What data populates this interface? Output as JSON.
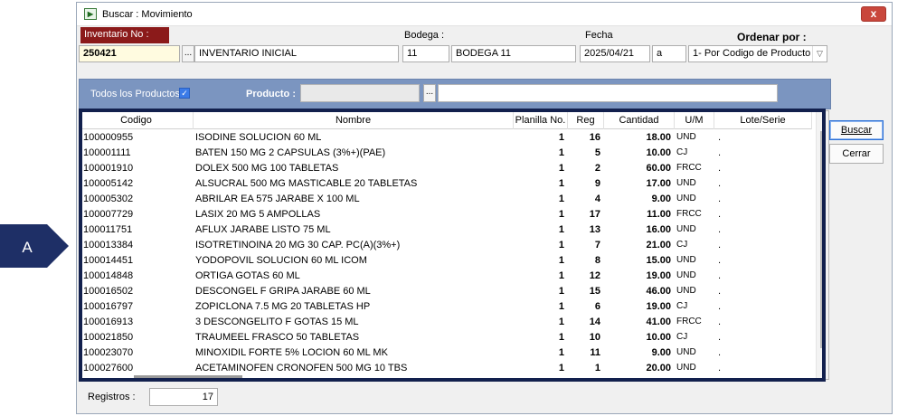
{
  "window": {
    "title": "Buscar : Movimiento",
    "close": "x"
  },
  "form": {
    "inventario_label": "Inventario No  :",
    "inventario_no": "250421",
    "inventario_desc": "INVENTARIO INICIAL",
    "bodega_label": "Bodega :",
    "bodega_code": "11",
    "bodega_name": "BODEGA 11",
    "fecha_label": "Fecha",
    "fecha": "2025/04/21",
    "fecha_a": "a",
    "ordenar_label": "Ordenar por :",
    "ordenar_value": "1- Por Codigo de Producto",
    "dots": "..."
  },
  "filter": {
    "todos_label": "Todos los Productos",
    "todos_checked": "✓",
    "producto_label": "Producto :",
    "dots": "..."
  },
  "grid": {
    "columns": [
      "Codigo",
      "Nombre",
      "Planilla No.",
      "Reg",
      "Cantidad",
      "U/M",
      "Lote/Serie"
    ],
    "rows": [
      {
        "codigo": "100000955",
        "nombre": "ISODINE SOLUCION 60 ML",
        "planilla": "1",
        "reg": "16",
        "cantidad": "18.00",
        "um": "UND",
        "lote": "."
      },
      {
        "codigo": "100001111",
        "nombre": "BATEN 150 MG 2 CAPSULAS (3%+)(PAE)",
        "planilla": "1",
        "reg": "5",
        "cantidad": "10.00",
        "um": "CJ",
        "lote": "."
      },
      {
        "codigo": "100001910",
        "nombre": "DOLEX 500 MG 100 TABLETAS",
        "planilla": "1",
        "reg": "2",
        "cantidad": "60.00",
        "um": "FRCC",
        "lote": "."
      },
      {
        "codigo": "100005142",
        "nombre": "ALSUCRAL 500 MG MASTICABLE 20 TABLETAS",
        "planilla": "1",
        "reg": "9",
        "cantidad": "17.00",
        "um": "UND",
        "lote": "."
      },
      {
        "codigo": "100005302",
        "nombre": "ABRILAR EA 575 JARABE X 100 ML",
        "planilla": "1",
        "reg": "4",
        "cantidad": "9.00",
        "um": "UND",
        "lote": "."
      },
      {
        "codigo": "100007729",
        "nombre": "LASIX 20 MG 5 AMPOLLAS",
        "planilla": "1",
        "reg": "17",
        "cantidad": "11.00",
        "um": "FRCC",
        "lote": "."
      },
      {
        "codigo": "100011751",
        "nombre": "AFLUX JARABE LISTO 75 ML",
        "planilla": "1",
        "reg": "13",
        "cantidad": "16.00",
        "um": "UND",
        "lote": "."
      },
      {
        "codigo": "100013384",
        "nombre": "ISOTRETINOINA 20 MG 30 CAP. PC(A)(3%+)",
        "planilla": "1",
        "reg": "7",
        "cantidad": "21.00",
        "um": "CJ",
        "lote": "."
      },
      {
        "codigo": "100014451",
        "nombre": "YODOPOVIL SOLUCION 60 ML ICOM",
        "planilla": "1",
        "reg": "8",
        "cantidad": "15.00",
        "um": "UND",
        "lote": "."
      },
      {
        "codigo": "100014848",
        "nombre": "ORTIGA GOTAS 60 ML",
        "planilla": "1",
        "reg": "12",
        "cantidad": "19.00",
        "um": "UND",
        "lote": "."
      },
      {
        "codigo": "100016502",
        "nombre": "DESCONGEL F GRIPA JARABE 60 ML",
        "planilla": "1",
        "reg": "15",
        "cantidad": "46.00",
        "um": "UND",
        "lote": "."
      },
      {
        "codigo": "100016797",
        "nombre": "ZOPICLONA 7.5 MG 20 TABLETAS HP",
        "planilla": "1",
        "reg": "6",
        "cantidad": "19.00",
        "um": "CJ",
        "lote": "."
      },
      {
        "codigo": "100016913",
        "nombre": "3 DESCONGELITO F GOTAS 15 ML",
        "planilla": "1",
        "reg": "14",
        "cantidad": "41.00",
        "um": "FRCC",
        "lote": "."
      },
      {
        "codigo": "100021850",
        "nombre": "TRAUMEEL FRASCO 50 TABLETAS",
        "planilla": "1",
        "reg": "10",
        "cantidad": "10.00",
        "um": "CJ",
        "lote": "."
      },
      {
        "codigo": "100023070",
        "nombre": "MINOXIDIL FORTE 5% LOCION 60 ML MK",
        "planilla": "1",
        "reg": "11",
        "cantidad": "9.00",
        "um": "UND",
        "lote": "."
      },
      {
        "codigo": "100027600",
        "nombre": "ACETAMINOFEN CRONOFEN 500 MG 10 TBS",
        "planilla": "1",
        "reg": "1",
        "cantidad": "20.00",
        "um": "UND",
        "lote": "."
      }
    ]
  },
  "buttons": {
    "buscar": "Buscar",
    "cerrar": "Cerrar"
  },
  "footer": {
    "registros_label": "Registros :",
    "registros": "17"
  },
  "annotation": {
    "badge": "A",
    "frame_color": "#12204d",
    "badge_color": "#1e2f66"
  }
}
